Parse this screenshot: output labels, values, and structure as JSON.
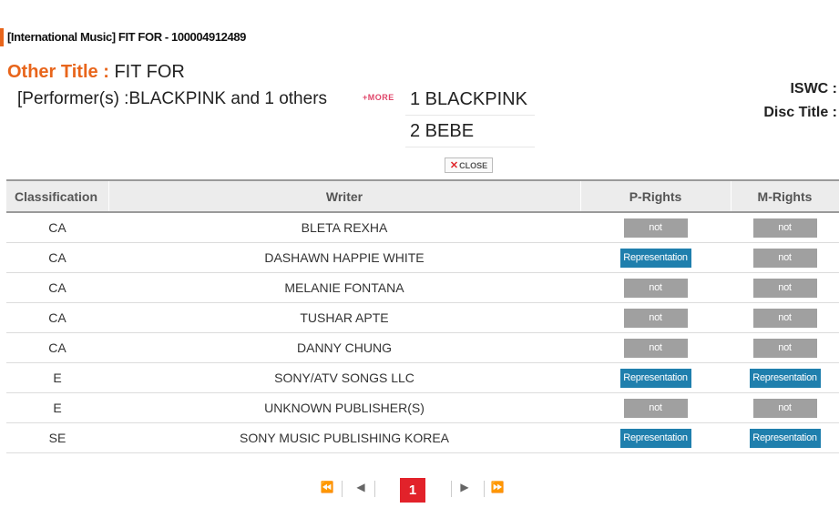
{
  "header": {
    "title": "[International Music] FIT FOR - 100004912489"
  },
  "other_title": {
    "label": "Other Title :",
    "value": "FIT FOR"
  },
  "performers": {
    "text": "[Performer(s) :BLACKPINK and 1 others",
    "more_label": "+MORE",
    "items": [
      "1 BLACKPINK",
      "2 BEBE"
    ],
    "close_mark": "✕",
    "close_label": "CLOSE"
  },
  "meta": {
    "iswc_label": "ISWC :",
    "disc_title_label": "Disc Title :"
  },
  "table": {
    "headers": [
      "Classification",
      "Writer",
      "P-Rights",
      "M-Rights"
    ],
    "rows": [
      {
        "classification": "CA",
        "writer": "BLETA REXHA",
        "p_rights": "not",
        "m_rights": "not"
      },
      {
        "classification": "CA",
        "writer": "DASHAWN HAPPIE WHITE",
        "p_rights": "Representation",
        "m_rights": "not"
      },
      {
        "classification": "CA",
        "writer": "MELANIE FONTANA",
        "p_rights": "not",
        "m_rights": "not"
      },
      {
        "classification": "CA",
        "writer": "TUSHAR APTE",
        "p_rights": "not",
        "m_rights": "not"
      },
      {
        "classification": "CA",
        "writer": "DANNY CHUNG",
        "p_rights": "not",
        "m_rights": "not"
      },
      {
        "classification": "E",
        "writer": "SONY/ATV SONGS LLC",
        "p_rights": "Representation",
        "m_rights": "Representation"
      },
      {
        "classification": "E",
        "writer": "UNKNOWN PUBLISHER(S)",
        "p_rights": "not",
        "m_rights": "not"
      },
      {
        "classification": "SE",
        "writer": "SONY MUSIC PUBLISHING KOREA",
        "p_rights": "Representation",
        "m_rights": "Representation"
      }
    ]
  },
  "pagination": {
    "first": "⏪",
    "prev": "◀",
    "current": "1",
    "next": "▶",
    "last": "⏩"
  },
  "colors": {
    "accent": "#e8651b",
    "badge_not": "#a0a0a0",
    "badge_representation": "#1f7fad",
    "page_current": "#e2222a"
  }
}
